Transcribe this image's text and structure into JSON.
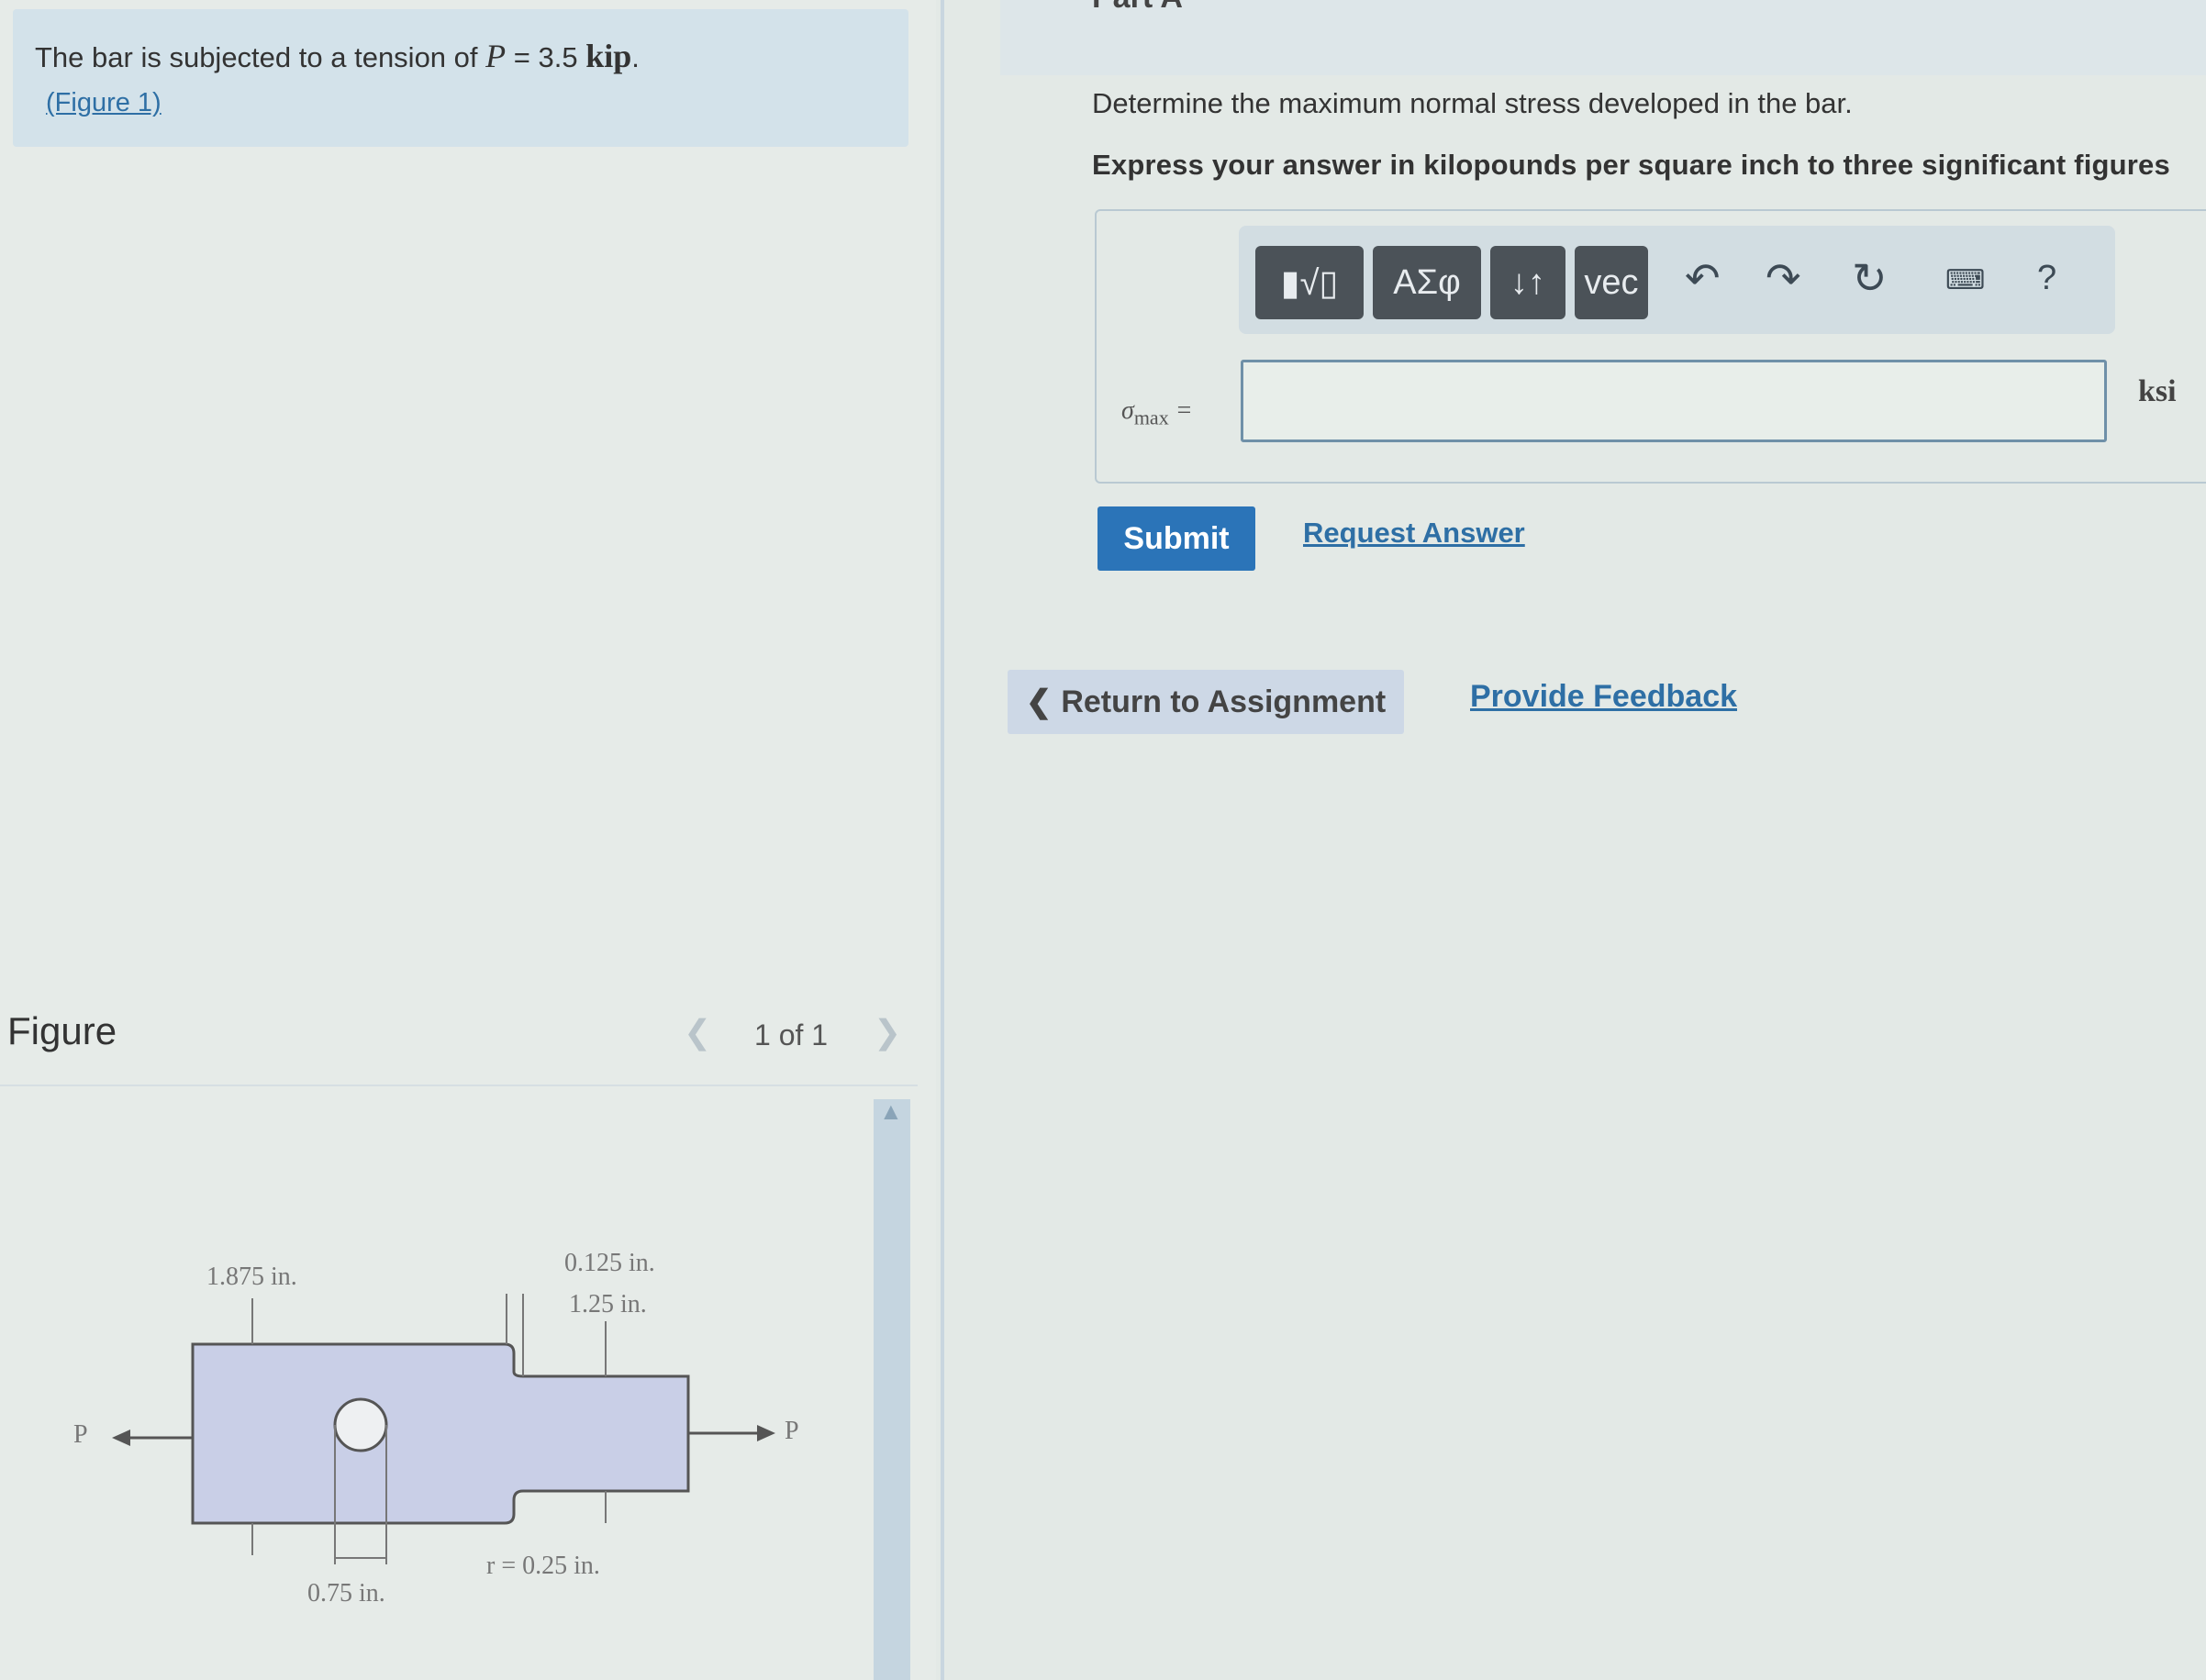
{
  "prompt": {
    "text_before": "The bar is subjected to a tension of",
    "var": "P",
    "eq": " = 3.5 ",
    "unit": "kip",
    "end": ".",
    "figure_link": "(Figure 1)"
  },
  "part": {
    "header": "Part A",
    "question": "Determine the maximum normal stress developed in the bar.",
    "instruction": "Express your answer in kilopounds per square inch to three significant figures",
    "toolbar": {
      "template_label": "▮√▯",
      "greek_label": "ΑΣφ",
      "arrows_label": "↓↑",
      "vec_label": "vec",
      "help_label": "?"
    },
    "answer": {
      "label_sym": "σ",
      "label_sub": "max",
      "label_eq": " =",
      "value": "",
      "unit": "ksi"
    },
    "submit_label": "Submit",
    "request_label": "Request Answer"
  },
  "nav": {
    "return_label": "Return to Assignment",
    "feedback_label": "Provide Feedback"
  },
  "figure": {
    "title": "Figure",
    "pager": "1 of 1",
    "labels": {
      "dim_left": "1.875 in.",
      "dim_top_small": "0.125 in.",
      "dim_top": "1.25 in.",
      "hole": "0.75 in.",
      "radius": "r = 0.25 in.",
      "load_left": "P",
      "load_right": "P"
    }
  }
}
